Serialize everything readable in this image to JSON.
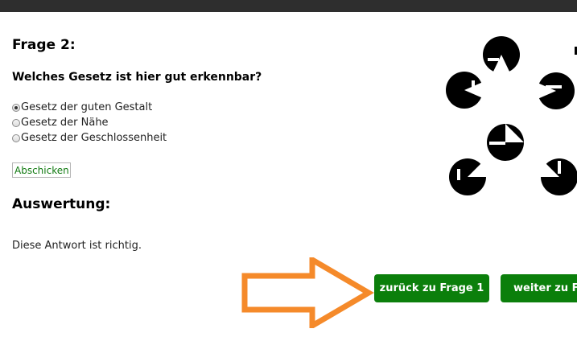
{
  "question": {
    "title": "Frage 2:",
    "prompt": "Welches Gesetz ist hier gut erkennbar?",
    "options": [
      {
        "label": "Gesetz der guten Gestalt",
        "checked": true
      },
      {
        "label": "Gesetz der Nähe",
        "checked": false
      },
      {
        "label": "Gesetz der Geschlossenheit",
        "checked": false
      }
    ],
    "submit_label": "Abschicken"
  },
  "evaluation": {
    "heading": "Auswertung:",
    "text": "Diese Antwort ist richtig."
  },
  "navigation": {
    "prev_label": "zurück zu Frage 1",
    "next_label": "weiter zu Fra"
  },
  "colors": {
    "topbar": "#2e2e2e",
    "button_green": "#0b7f0b",
    "arrow_orange": "#f58a2a"
  }
}
